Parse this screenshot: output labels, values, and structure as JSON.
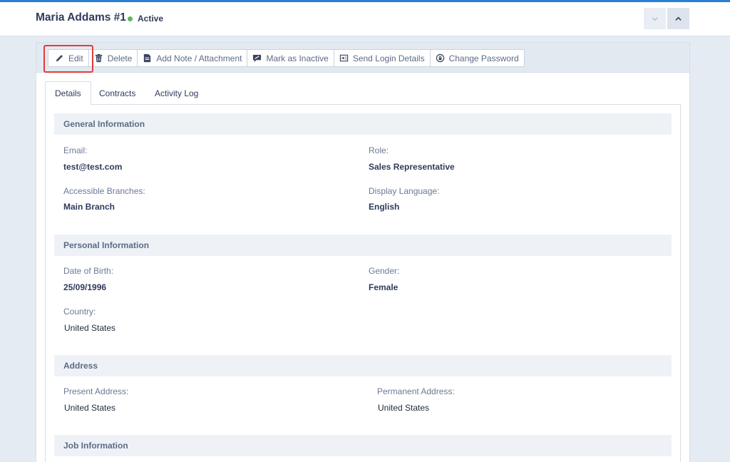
{
  "header": {
    "title": "Maria Addams #1",
    "status": "Active",
    "status_color": "#5cb85c",
    "nav_down_icon": "chevron-down-icon",
    "nav_up_icon": "chevron-up-icon"
  },
  "toolbar": {
    "edit": "Edit",
    "delete": "Delete",
    "add_note": "Add Note / Attachment",
    "mark_inactive": "Mark as Inactive",
    "send_login": "Send Login Details",
    "change_password": "Change Password",
    "highlight_color": "#e23b3b"
  },
  "tabs": [
    {
      "label": "Details"
    },
    {
      "label": "Contracts"
    },
    {
      "label": "Activity Log"
    }
  ],
  "sections": {
    "general": {
      "title": "General Information",
      "email_label": "Email:",
      "email": "test@test.com",
      "role_label": "Role:",
      "role": "Sales Representative",
      "branches_label": "Accessible Branches:",
      "branches": "Main Branch",
      "language_label": "Display Language:",
      "language": "English"
    },
    "personal": {
      "title": "Personal Information",
      "dob_label": "Date of Birth:",
      "dob": "25/09/1996",
      "gender_label": "Gender:",
      "gender": "Female",
      "country_label": "Country:",
      "country": "United States"
    },
    "address": {
      "title": "Address",
      "present_label": "Present Address:",
      "present": "United States",
      "permanent_label": "Permanent Address:",
      "permanent": "United States"
    },
    "job": {
      "title": "Job Information"
    }
  }
}
